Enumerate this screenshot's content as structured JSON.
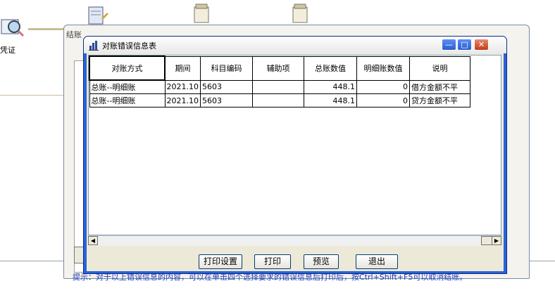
{
  "desktop": {
    "left_label": "凭证",
    "outer_title": "结账",
    "hint": "提示：对于以上错误信息的内容，可以在单击四个选择要求的错误信息后打印后，按Ctrl+Shift+F5可以取消结账。"
  },
  "window": {
    "title": "对账错误信息表",
    "min_label": "—",
    "max_label": "□",
    "close_label": "✕"
  },
  "table": {
    "columns": [
      "对账方式",
      "期间",
      "科目编码",
      "辅助项",
      "总账数值",
      "明细账数值",
      "说明"
    ],
    "rows": [
      [
        "总账--明细账",
        "2021.10",
        "5603",
        "",
        "448.1",
        "0",
        "借方金额不平"
      ],
      [
        "总账--明细账",
        "2021.10",
        "5603",
        "",
        "448.1",
        "0",
        "贷方金额不平"
      ]
    ]
  },
  "buttons": {
    "print_setup": "打印设置",
    "print": "打印",
    "preview": "预览",
    "exit": "退出"
  }
}
